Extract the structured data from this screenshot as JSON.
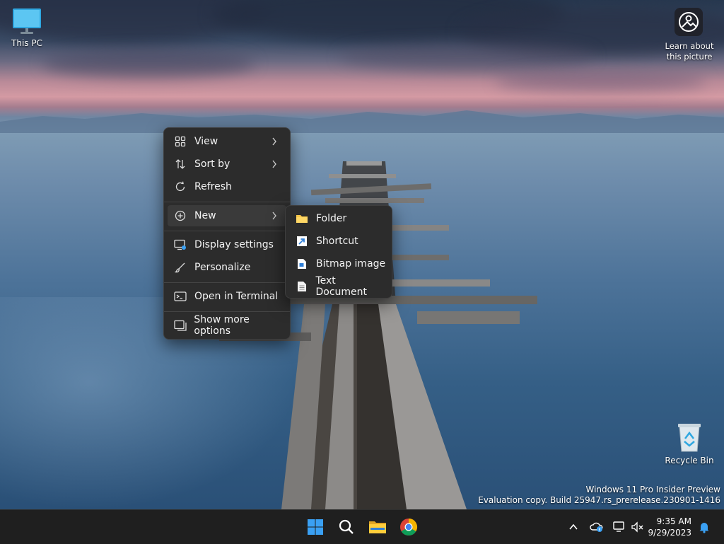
{
  "desktop": {
    "this_pc_label": "This PC",
    "recycle_bin_label": "Recycle Bin",
    "learn_line1": "Learn about",
    "learn_line2": "this picture"
  },
  "context_menu": {
    "items": [
      {
        "label": "View",
        "icon": "view-grid-icon",
        "submenu": true
      },
      {
        "label": "Sort by",
        "icon": "sort-icon",
        "submenu": true
      },
      {
        "label": "Refresh",
        "icon": "refresh-icon",
        "submenu": false
      },
      {
        "label": "New",
        "icon": "new-plus-icon",
        "submenu": true,
        "active": true
      },
      {
        "label": "Display settings",
        "icon": "display-icon",
        "submenu": false
      },
      {
        "label": "Personalize",
        "icon": "brush-icon",
        "submenu": false
      },
      {
        "label": "Open in Terminal",
        "icon": "terminal-icon",
        "submenu": false
      },
      {
        "label": "Show more options",
        "icon": "more-options-icon",
        "submenu": false
      }
    ]
  },
  "new_submenu": {
    "items": [
      {
        "label": "Folder",
        "icon": "folder-icon"
      },
      {
        "label": "Shortcut",
        "icon": "shortcut-icon"
      },
      {
        "label": "Bitmap image",
        "icon": "bitmap-icon"
      },
      {
        "label": "Text Document",
        "icon": "text-document-icon"
      }
    ]
  },
  "watermark": {
    "line1": "Windows 11 Pro Insider Preview",
    "line2": "Evaluation copy. Build 25947.rs_prerelease.230901-1416"
  },
  "taskbar": {
    "time": "9:35 AM",
    "date": "9/29/2023"
  },
  "colors": {
    "menu_bg": "#2c2c2c",
    "menu_hover": "#3a3a3a",
    "taskbar_bg": "#1f1f1f",
    "windows_blue": "#3aa0f3",
    "folder_yellow": "#f7c64a"
  }
}
